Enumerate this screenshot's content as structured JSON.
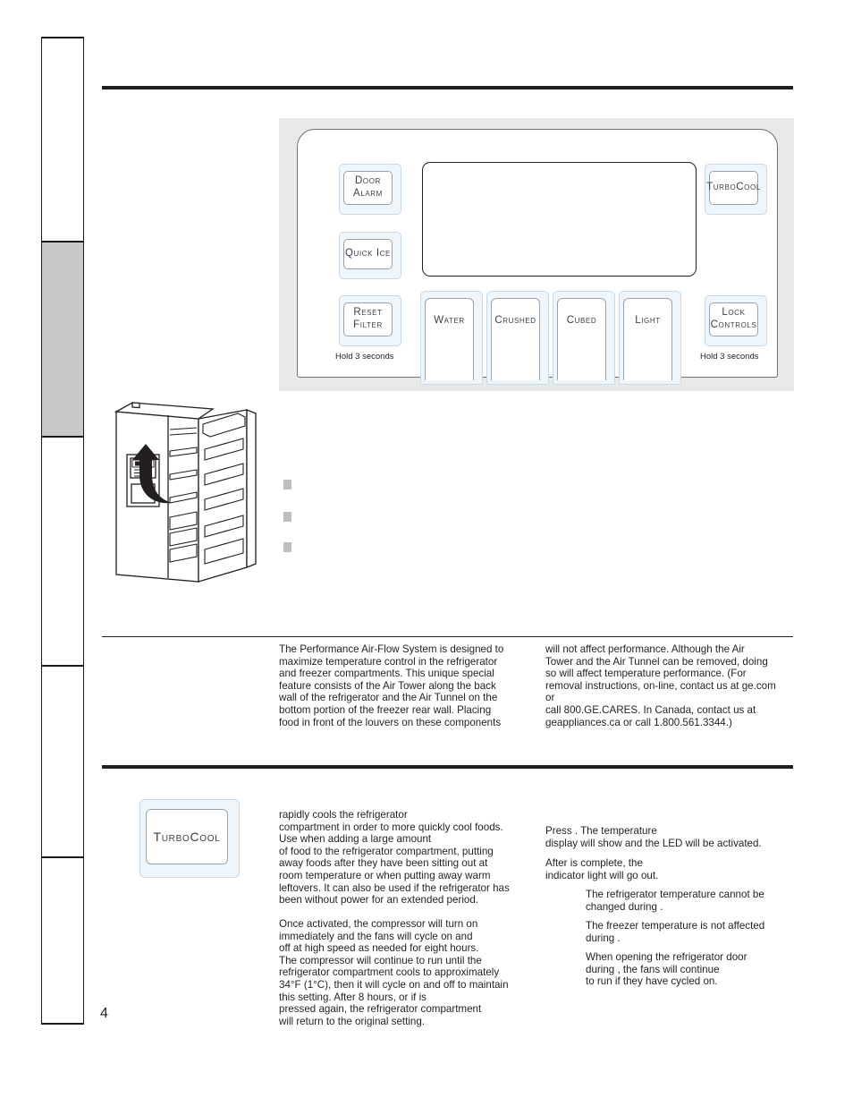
{
  "page": {
    "number": "4",
    "sidebar_tabs": [
      {
        "label": "",
        "shaded": false
      },
      {
        "label": "",
        "shaded": true
      },
      {
        "label": "",
        "shaded": false
      },
      {
        "label": "",
        "shaded": false
      },
      {
        "label": "",
        "shaded": false
      }
    ]
  },
  "control_panel": {
    "buttons": {
      "door_alarm": "Door\nAlarm",
      "quick_ice": "Quick Ice",
      "reset_filter": "Reset\nFilter",
      "water": "Water",
      "crushed": "Crushed",
      "cubed": "Cubed",
      "light": "Light",
      "turbocool": "TurboCool",
      "lock_controls": "Lock\nControls"
    },
    "hold_notes": {
      "reset_filter": "Hold  3 seconds",
      "lock_controls": "Hold  3 seconds"
    }
  },
  "bullets": [
    "",
    "",
    ""
  ],
  "airflow_section": {
    "left_column": "The Performance Air-Flow System is designed to\nmaximize temperature control in the refrigerator\nand freezer compartments. This unique special\nfeature consists of the Air Tower along the back\nwall of the refrigerator and the Air Tunnel on the\nbottom portion of the freezer rear wall. Placing\nfood in front of the louvers on these components",
    "right_column": "will not affect performance. Although the Air\nTower and the Air Tunnel can be removed, doing\nso will affect temperature performance. (For\nremoval instructions, on-line, contact us at ge.com\nor\ncall 800.GE.CARES. In Canada, contact us at\ngeappliances.ca or call 1.800.561.3344.)"
  },
  "turbocool_section": {
    "button_label": "TurboCool",
    "left_paragraph_1": "                    rapidly cools the refrigerator\ncompartment in order to more quickly cool foods.\nUse                      when adding a large amount\nof food to the refrigerator compartment, putting\naway foods after they have been sitting out at\nroom temperature or when putting away warm\nleftovers. It can also be used if the refrigerator has\nbeen without power for an extended period.",
    "left_paragraph_2": "Once activated, the compressor will turn on\nimmediately and the fans will cycle on and\noff at high speed as needed for eight hours.\nThe compressor will continue to run until the\nrefrigerator compartment cools to approximately\n34°F (1°C), then it will cycle on and off to maintain\nthis setting. After 8 hours, or if                        is\npressed again, the refrigerator compartment\nwill return to the original setting.",
    "right_paragraph_1": "Press                  . The                        temperature\ndisplay will show        and the LED will be activated.",
    "right_paragraph_2": "After                      is complete, the\nindicator light will go out.",
    "notes": [
      "The refrigerator temperature cannot be\nchanged during                         .",
      "The freezer temperature is not affected\nduring                      .",
      "When opening the refrigerator door\nduring                      , the fans will continue\nto run if they have cycled on."
    ]
  }
}
